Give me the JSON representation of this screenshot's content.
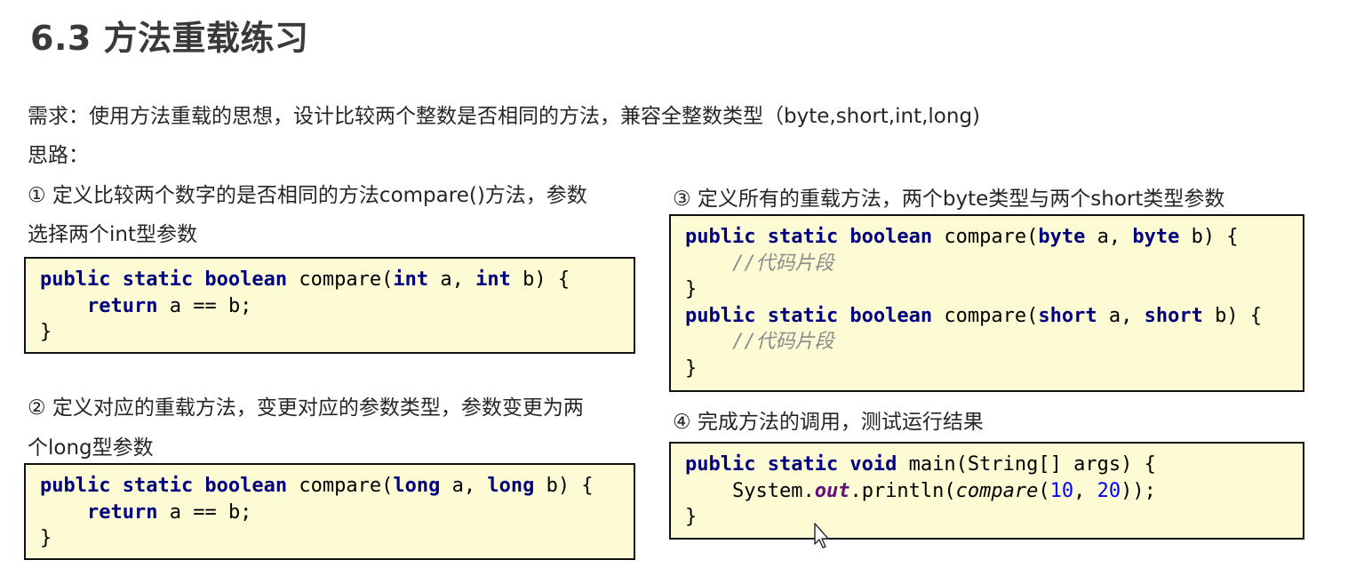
{
  "slide": {
    "title": "6.3 方法重载练习",
    "requirement": "需求：使用方法重载的思想，设计比较两个整数是否相同的方法，兼容全整数类型（byte,short,int,long)",
    "approach_label": "思路："
  },
  "steps": [
    {
      "number": "①",
      "lines": [
        "① 定义比较两个数字的是否相同的方法compare()方法，参数",
        "选择两个int型参数"
      ]
    },
    {
      "number": "②",
      "lines": [
        "② 定义对应的重载方法，变更对应的参数类型，参数变更为两",
        "个long型参数"
      ]
    },
    {
      "number": "③",
      "lines": [
        "③ 定义所有的重载方法，两个byte类型与两个short类型参数"
      ]
    },
    {
      "number": "④",
      "lines": [
        "④ 完成方法的调用，测试运行结果"
      ]
    }
  ],
  "code": {
    "block1": {
      "l1_kw": "public static boolean",
      "l1_name": " compare(",
      "l1_t1": "int",
      "l1_mid": " a, ",
      "l1_t2": "int",
      "l1_end": " b) {",
      "l2_indent": "    ",
      "l2_kw": "return",
      "l2_rest": " a == b;",
      "l3": "}"
    },
    "block2": {
      "l1_kw": "public static boolean",
      "l1_name": " compare(",
      "l1_t1": "long",
      "l1_mid": " a, ",
      "l1_t2": "long",
      "l1_end": " b) {",
      "l2_indent": "    ",
      "l2_kw": "return",
      "l2_rest": " a == b;",
      "l3": "}"
    },
    "block3": {
      "l1_kw": "public static boolean",
      "l1_name": " compare(",
      "l1_t1": "byte",
      "l1_mid": " a, ",
      "l1_t2": "byte",
      "l1_end": " b) {",
      "l2_indent": "    ",
      "l2_comment": "//代码片段",
      "l3": "}",
      "l4_kw": "public static boolean",
      "l4_name": " compare(",
      "l4_t1": "short",
      "l4_mid": " a, ",
      "l4_t2": "short",
      "l4_end": " b) {",
      "l5_indent": "    ",
      "l5_comment": "//代码片段",
      "l6": "}"
    },
    "block4": {
      "l1_kw": "public static void",
      "l1_rest": " main(String[] args) {",
      "l2_indent": "    ",
      "l2_sys": "System.",
      "l2_out": "out",
      "l2_print": ".println(",
      "l2_call": "compare",
      "l2_open": "(",
      "l2_n1": "10",
      "l2_comma": ", ",
      "l2_n2": "20",
      "l2_close": "));",
      "l3": "}"
    }
  },
  "icons": {
    "cursor": "mouse-pointer-icon"
  }
}
